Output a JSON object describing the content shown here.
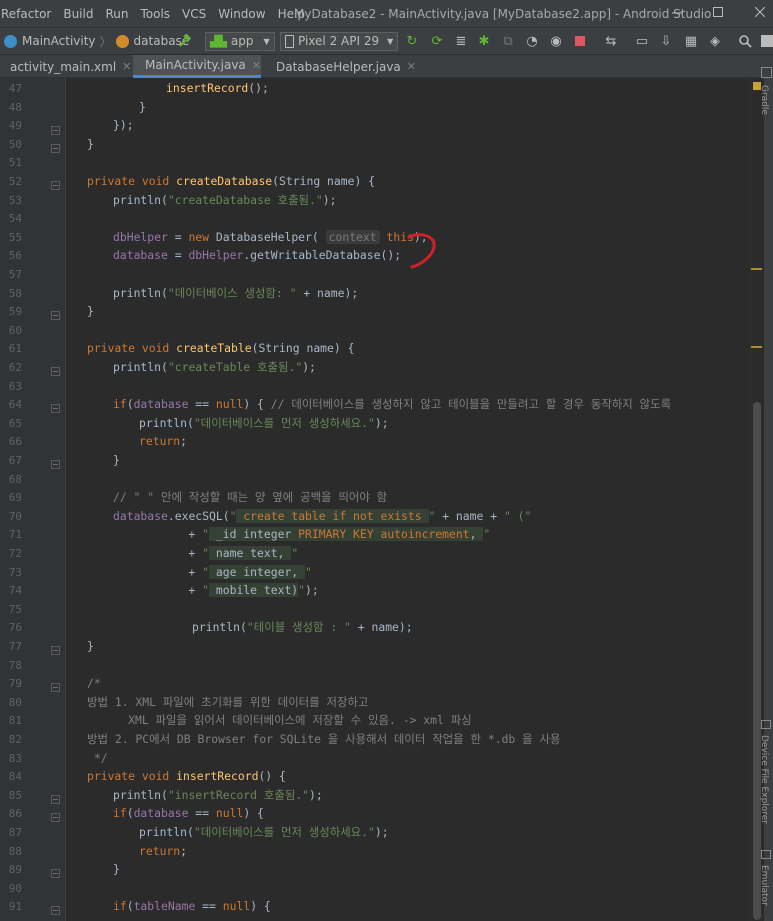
{
  "menubar": {
    "items": [
      "Refactor",
      "Build",
      "Run",
      "Tools",
      "VCS",
      "Window",
      "Help"
    ],
    "title": "MyDatabase2 - MainActivity.java [MyDatabase2.app] - Android Studio",
    "controls": [
      "minimize-icon",
      "maximize-icon",
      "close-icon"
    ]
  },
  "toolbar": {
    "breadcrumb": [
      "MainActivity",
      "database"
    ],
    "run_config": "app",
    "device": "Pixel 2 API 29",
    "icons": [
      "hammer-icon",
      "rerun-icon",
      "apply-changes-icon",
      "apply-code-icon",
      "debug-icon",
      "attach-debugger-icon",
      "profile-icon",
      "coverage-icon",
      "stop-icon",
      "sync-icon",
      "avd-manager-icon",
      "sdk-manager-icon",
      "layout-inspector-icon",
      "search-icon"
    ],
    "colors": {
      "green": "#5fb832",
      "red": "#db5860"
    }
  },
  "tabs": [
    {
      "label": "activity_main.xml",
      "active": false
    },
    {
      "label": "MainActivity.java",
      "active": true
    },
    {
      "label": "DatabaseHelper.java",
      "active": false
    }
  ],
  "side_labels": {
    "top": "Gradle",
    "middle": "Device File Explorer",
    "bottom": "Emulator"
  },
  "lines": [
    {
      "n": "47",
      "code": "            insertRecord();"
    },
    {
      "n": "48",
      "code": "        }"
    },
    {
      "n": "49",
      "code": "    });"
    },
    {
      "n": "50",
      "code": "}"
    },
    {
      "n": "51",
      "code": ""
    },
    {
      "n": "52",
      "code": "private void createDatabase(String name) {"
    },
    {
      "n": "53",
      "code": "    println(\"createDatabase 호출됨.\");"
    },
    {
      "n": "54",
      "code": ""
    },
    {
      "n": "55",
      "code": "    dbHelper = new DatabaseHelper( context this);"
    },
    {
      "n": "56",
      "code": "    database = dbHelper.getWritableDatabase();"
    },
    {
      "n": "57",
      "code": ""
    },
    {
      "n": "58",
      "code": "    println(\"데이터베이스 생성함: \" + name);"
    },
    {
      "n": "59",
      "code": "}"
    },
    {
      "n": "60",
      "code": ""
    },
    {
      "n": "61",
      "code": "private void createTable(String name) {"
    },
    {
      "n": "62",
      "code": "    println(\"createTable 호출됨.\");"
    },
    {
      "n": "63",
      "code": ""
    },
    {
      "n": "64",
      "code": "    if(database == null) { // 데이터베이스를 생성하지 않고 테이블을 만들려고 할 경우 동작하지 않도록"
    },
    {
      "n": "65",
      "code": "        println(\"데이터베이스를 먼저 생성하세요.\");"
    },
    {
      "n": "66",
      "code": "        return;"
    },
    {
      "n": "67",
      "code": "    }"
    },
    {
      "n": "68",
      "code": ""
    },
    {
      "n": "69",
      "code": "    // \" \" 안에 작성할 때는 양 옆에 공백을 띄어야 함"
    },
    {
      "n": "70",
      "code": "    database.execSQL(\" create table if not exists \" + name + \" (\""
    },
    {
      "n": "71",
      "code": "               + \" _id integer PRIMARY KEY autoincrement, \""
    },
    {
      "n": "72",
      "code": "               + \" name text, \""
    },
    {
      "n": "73",
      "code": "               + \" age integer, \""
    },
    {
      "n": "74",
      "code": "               + \" mobile text)\");"
    },
    {
      "n": "75",
      "code": ""
    },
    {
      "n": "76",
      "code": "                println(\"테이블 생성함 : \" + name);"
    },
    {
      "n": "77",
      "code": "}"
    },
    {
      "n": "78",
      "code": ""
    },
    {
      "n": "79",
      "code": "/*"
    },
    {
      "n": "80",
      "code": "방법 1. XML 파일에 초기화를 위한 데이터를 저장하고"
    },
    {
      "n": "81",
      "code": "      XML 파일을 읽어서 데이터베이스에 저장할 수 있음. -> xml 파싱"
    },
    {
      "n": "82",
      "code": "방법 2. PC에서 DB Browser for SQLite 을 사용해서 데이터 작업을 한 *.db 을 사용"
    },
    {
      "n": "83",
      "code": " */"
    },
    {
      "n": "84",
      "code": "private void insertRecord() {"
    },
    {
      "n": "85",
      "code": "    println(\"insertRecord 호출됨.\");"
    },
    {
      "n": "86",
      "code": "    if(database == null) {"
    },
    {
      "n": "87",
      "code": "        println(\"데이터베이스를 먼저 생성하세요.\");"
    },
    {
      "n": "88",
      "code": "        return;"
    },
    {
      "n": "89",
      "code": "    }"
    },
    {
      "n": "90",
      "code": ""
    },
    {
      "n": "91",
      "code": "    if(tableName == null) {"
    }
  ]
}
